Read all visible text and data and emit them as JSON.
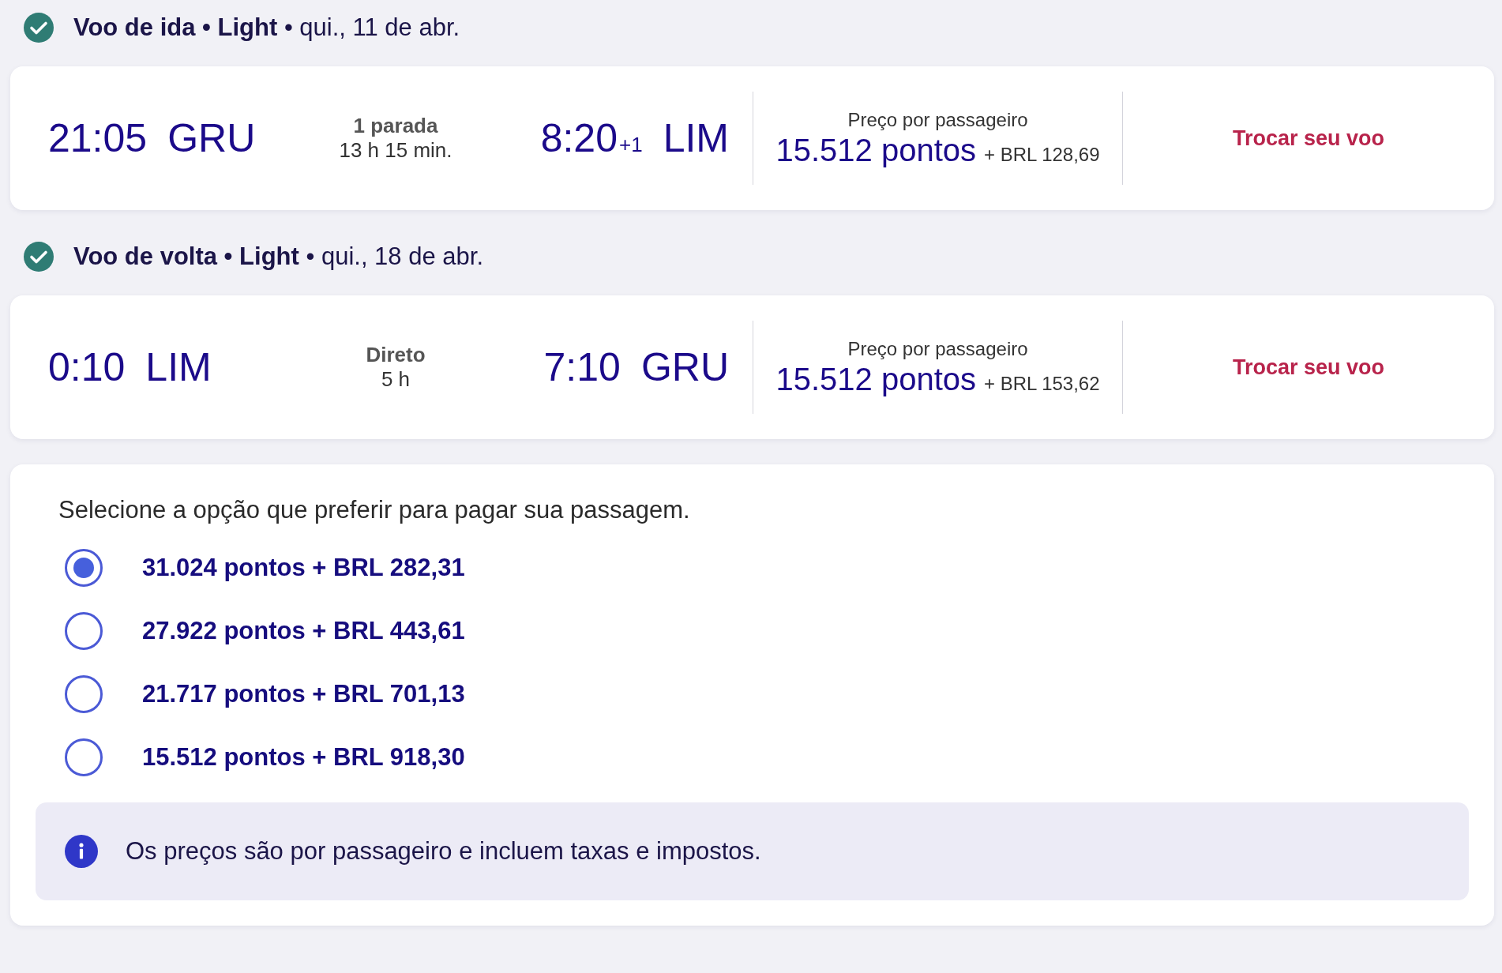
{
  "flights": [
    {
      "confirmed": true,
      "heading": "**Voo de ida • Light** • qui., 11 de abr.",
      "departure": {
        "time": "21:05",
        "airport": "GRU"
      },
      "stops": {
        "label": "1 parada",
        "duration": "13 h 15 min."
      },
      "arrival": {
        "time": "8:20",
        "day_offset": "+1",
        "airport": "LIM"
      },
      "price_label": "Preço por passageiro",
      "points": "15.512 pontos",
      "cash": "+ BRL 128,69",
      "change_link": "Trocar seu voo"
    },
    {
      "confirmed": true,
      "heading": "**Voo de volta • Light** • qui., 18 de abr.",
      "departure": {
        "time": "0:10",
        "airport": "LIM"
      },
      "stops": {
        "label": "Direto",
        "duration": "5 h"
      },
      "arrival": {
        "time": "7:10",
        "airport": "GRU"
      },
      "price_label": "Preço por passageiro",
      "points": "15.512 pontos",
      "cash": "+ BRL 153,62",
      "change_link": "Trocar seu voo"
    }
  ],
  "payment": {
    "prompt": "Selecione a opção que preferir para pagar sua passagem.",
    "options": [
      {
        "label": "31.024 pontos + BRL 282,31",
        "selected": true
      },
      {
        "label": "27.922 pontos + BRL 443,61",
        "selected": false
      },
      {
        "label": "21.717 pontos + BRL 701,13",
        "selected": false
      },
      {
        "label": "15.512 pontos + BRL 918,30",
        "selected": false
      }
    ],
    "info": "Os preços são por passageiro e incluem taxas e impostos."
  }
}
